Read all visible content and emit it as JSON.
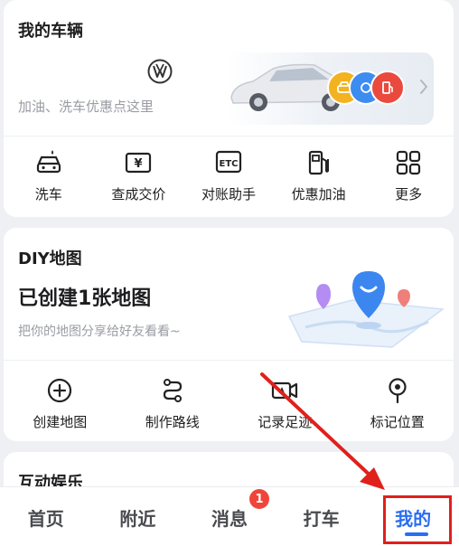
{
  "vehicle": {
    "title": "我的车辆",
    "promo_text": "加油、洗车优惠点这里",
    "actions": [
      {
        "label": "洗车",
        "icon": "car-wash-icon"
      },
      {
        "label": "查成交价",
        "icon": "price-tag-icon"
      },
      {
        "label": "对账助手",
        "icon": "etc-icon"
      },
      {
        "label": "优惠加油",
        "icon": "fuel-pump-icon"
      },
      {
        "label": "更多",
        "icon": "grid-more-icon"
      }
    ]
  },
  "diy_map": {
    "title": "DIY地图",
    "subtitle": "已创建1张地图",
    "promo_text": "把你的地图分享给好友看看~",
    "actions": [
      {
        "label": "创建地图",
        "icon": "plus-circle-icon"
      },
      {
        "label": "制作路线",
        "icon": "route-icon"
      },
      {
        "label": "记录足迹",
        "icon": "video-camera-icon"
      },
      {
        "label": "标记位置",
        "icon": "location-pin-icon"
      }
    ]
  },
  "interactive": {
    "title": "互动娱乐"
  },
  "bottom_nav": {
    "tabs": [
      {
        "label": "首页"
      },
      {
        "label": "附近"
      },
      {
        "label": "消息"
      },
      {
        "label": "打车"
      },
      {
        "label": "我的"
      }
    ],
    "message_badge": "1",
    "active_tab": "我的"
  },
  "colors": {
    "accent": "#2a6df4",
    "badge": "#f0443a",
    "annotation": "#e0201b"
  }
}
